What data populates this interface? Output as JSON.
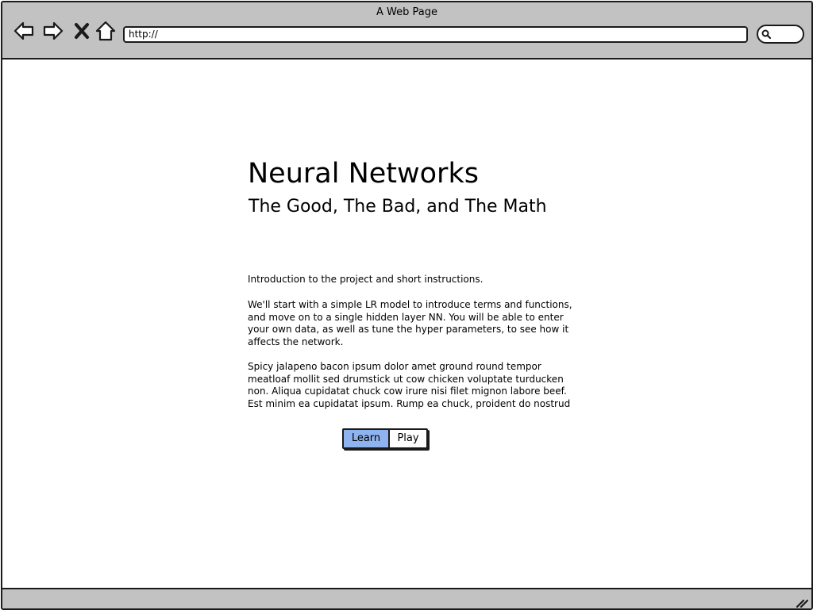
{
  "window": {
    "title": "A Web Page"
  },
  "toolbar": {
    "back_icon": "back-arrow-icon",
    "forward_icon": "forward-arrow-icon",
    "stop_icon": "close-icon",
    "home_icon": "home-icon",
    "url": "http://",
    "search_icon": "search-icon"
  },
  "page": {
    "title": "Neural Networks",
    "subtitle": "The Good, The Bad, and The Math",
    "paragraphs": [
      "Introduction to the project and short instructions.",
      "We'll start with a simple LR model to introduce terms and functions, and move on to a single hidden layer NN. You will be able to enter your own data, as well as tune the hyper parameters, to see how it affects the network.",
      "Spicy jalapeno bacon ipsum dolor amet ground round tempor meatloaf mollit sed drumstick ut cow chicken voluptate turducken non. Aliqua cupidatat chuck cow irure nisi filet mignon labore beef. Est minim ea cupidatat ipsum. Rump ea chuck, proident do nostrud"
    ],
    "buttons": {
      "learn": "Learn",
      "play": "Play"
    }
  },
  "colors": {
    "chrome": "#c2c2c2",
    "selected_button": "#8fb3ee",
    "border": "#1a1a1a"
  }
}
